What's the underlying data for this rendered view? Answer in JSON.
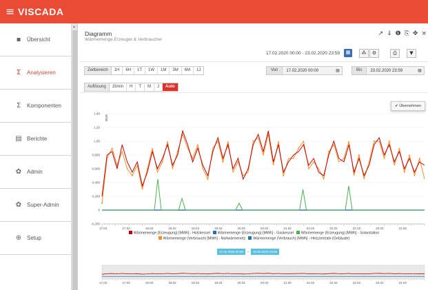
{
  "app": {
    "brand": "VISCADA",
    "menu_icon": "hamburger-icon"
  },
  "sidebar": {
    "items": [
      {
        "label": "Übersicht",
        "icon": "grid-icon",
        "glyph": "▪",
        "active": false
      },
      {
        "label": "Analysieren",
        "icon": "sigma-icon",
        "glyph": "Σ",
        "active": true
      },
      {
        "label": "Komponenten",
        "icon": "sigma-icon",
        "glyph": "Σ",
        "active": false
      },
      {
        "label": "Berichte",
        "icon": "report-icon",
        "glyph": "▤",
        "active": false
      },
      {
        "label": "Admin",
        "icon": "gears-icon",
        "glyph": "✿",
        "active": false
      },
      {
        "label": "Super-Admin",
        "icon": "gears-icon",
        "glyph": "✿",
        "active": false
      },
      {
        "label": "Setup",
        "icon": "setup-icon",
        "glyph": "⊕",
        "active": false
      }
    ]
  },
  "panel": {
    "title": "Diagramm",
    "subtitle": "Wärmemenge Erzeuger & Verbraucher",
    "tool_glyphs": [
      "↗",
      "⇓",
      "❶",
      "⎘",
      "✥",
      "×"
    ],
    "date_range_text": "17.02.2020 00:00 - 23.02.2020 23:59",
    "toolbar_glyphs": [
      "▦",
      "⁂",
      "⚙",
      "⎙",
      "▼"
    ]
  },
  "controls": {
    "zeitbereich_label": "Zeitbereich",
    "zeitbereich_options": [
      "1H",
      "6H",
      "1T",
      "1W",
      "1M",
      "3M",
      "6M",
      "1J"
    ],
    "aufloesung_label": "Auflösung",
    "aufloesung_options": [
      "15min",
      "H",
      "T",
      "M",
      "J",
      "Auto"
    ],
    "aufloesung_selected": "Auto",
    "von_label": "Von",
    "von_value": "17.02.2020 00:00",
    "bis_label": "Bis",
    "bis_value": "23.02.2020 23:59",
    "apply_label": "✔ Übernehmen"
  },
  "colors": {
    "brand": "#e94b35",
    "holzkessel": "#c00000",
    "gaskessel": "#1f6fb8",
    "solarstation": "#4caf50",
    "nahwaermenetz": "#f28e2b",
    "heizzentrale": "#1f7aa8"
  },
  "chart_data": {
    "type": "line",
    "ylabel": "MWh",
    "ylim": [
      -0.2,
      1.4
    ],
    "y_ticks": [
      "-0,200",
      "0",
      "0,200",
      "0,400",
      "0,600",
      "0,800",
      "1,00",
      "1,20",
      "1,40"
    ],
    "x_ticks": [
      "17.02",
      "17.02",
      "18.02",
      "18.02",
      "19.02",
      "19.02",
      "20.02",
      "20.02",
      "21.02",
      "21.02",
      "22.02",
      "22.02",
      "23.02",
      "23.02"
    ],
    "series": [
      {
        "name": "Wärmemenge (Erzeugung) [MWh] - Holzkessel",
        "color": "#c00000",
        "values": [
          0.2,
          0.8,
          0.85,
          0.6,
          0.95,
          0.7,
          0.55,
          0.7,
          0.35,
          0.55,
          0.85,
          0.6,
          0.75,
          0.95,
          0.65,
          0.8,
          1.15,
          0.95,
          0.7,
          0.9,
          0.65,
          0.5,
          0.85,
          1.05,
          0.75,
          0.95,
          0.6,
          0.75,
          0.45,
          0.6,
          0.95,
          1.1,
          0.85,
          1.15,
          0.7,
          0.95,
          0.55,
          0.7,
          0.8,
          0.85,
          0.95,
          0.65,
          0.75,
          0.55,
          0.5,
          0.8,
          1.0,
          0.75,
          0.7,
          0.95,
          0.55,
          0.75,
          0.5,
          0.65,
          0.95,
          1.05,
          0.8,
          0.95,
          0.7,
          0.85,
          0.6,
          0.75,
          0.55,
          0.7,
          0.65
        ]
      },
      {
        "name": "Wärmemenge (Erzeugung) [MWh] - Gaskessel",
        "color": "#1f6fb8",
        "values": [
          0,
          0,
          0,
          0,
          0,
          0,
          0,
          0
        ]
      },
      {
        "name": "Wärmemenge (Erzeugung) [MWh] - Solarstation",
        "color": "#4caf50",
        "spikes": [
          {
            "pos": 0.173,
            "value": 0.45
          },
          {
            "pos": 0.248,
            "value": 0.17
          },
          {
            "pos": 0.425,
            "value": 0.1
          },
          {
            "pos": 0.623,
            "value": 0.3
          },
          {
            "pos": 0.765,
            "value": 0.35
          }
        ]
      },
      {
        "name": "Wärmemenge (Verbrauch) [MWh] - Nahwärmenetz",
        "color": "#f28e2b",
        "values": [
          0.1,
          0.75,
          0.9,
          0.65,
          0.85,
          0.6,
          0.5,
          0.65,
          0.3,
          0.6,
          0.9,
          0.55,
          0.7,
          1.0,
          0.6,
          0.85,
          1.1,
          0.9,
          0.75,
          0.95,
          0.6,
          0.45,
          0.9,
          1.0,
          0.7,
          1.0,
          0.55,
          0.7,
          0.5,
          0.55,
          1.0,
          1.05,
          0.8,
          1.1,
          0.65,
          1.0,
          0.5,
          0.75,
          0.75,
          0.9,
          1.0,
          0.6,
          0.7,
          0.6,
          0.45,
          0.85,
          0.95,
          0.7,
          0.75,
          1.0,
          0.5,
          0.8,
          0.45,
          0.7,
          1.0,
          1.0,
          0.75,
          1.0,
          0.65,
          0.9,
          0.55,
          0.8,
          0.5,
          0.75,
          0.45
        ]
      },
      {
        "name": "Wärmemenge (Verbrauch) [MWh] - Heizzentrale (Gebäude)",
        "color": "#1f7aa8",
        "values": [
          0,
          0,
          0,
          0,
          0,
          0,
          0,
          0
        ]
      }
    ],
    "navigator": {
      "range_from": "17.02.2020 00:00",
      "range_to": "23.02.2020 23:59"
    }
  }
}
